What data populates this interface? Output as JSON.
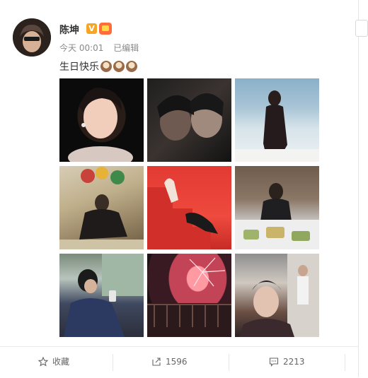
{
  "post": {
    "author": "陈坤",
    "time": "今天 00:01",
    "edited": "已编辑",
    "text": "生日快乐",
    "emoji": [
      "cake-emoji",
      "cake-emoji",
      "cake-emoji"
    ]
  },
  "badges": {
    "verified": "V",
    "verified_color": "#f5a623",
    "vip_color": "#ff6d3a"
  },
  "photos": [
    {
      "name": "photo-portrait-earrings"
    },
    {
      "name": "photo-two-faces-dark"
    },
    {
      "name": "photo-woman-beach"
    },
    {
      "name": "photo-balloons-room"
    },
    {
      "name": "photo-red-stairs"
    },
    {
      "name": "photo-table-food"
    },
    {
      "name": "photo-car-phone"
    },
    {
      "name": "photo-fireworks"
    },
    {
      "name": "photo-makeup-backstage"
    }
  ],
  "actions": {
    "favorite_label": "收藏",
    "share_count": "1596",
    "comment_count": "2213"
  }
}
